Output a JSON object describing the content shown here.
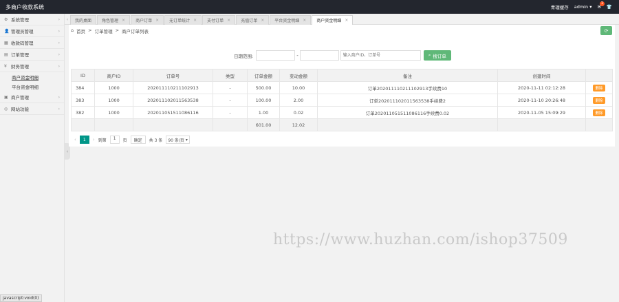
{
  "app_title": "多商户收款系统",
  "topbar": {
    "clear_cache": "青理缓存",
    "user": "admin",
    "notif_count": "1"
  },
  "sidebar": {
    "items": [
      {
        "label": "系统管理",
        "icon": "gear-icon"
      },
      {
        "label": "管理员管理",
        "icon": "user-icon"
      },
      {
        "label": "收款码管理",
        "icon": "qrcode-icon"
      },
      {
        "label": "订单管理",
        "icon": "doc-icon"
      },
      {
        "label": "财务管理",
        "icon": "money-icon"
      }
    ],
    "sub_items": [
      {
        "label": "商户资金明细",
        "active": true
      },
      {
        "label": "平台资金明细",
        "active": false
      }
    ],
    "items_after": [
      {
        "label": "商户管理",
        "icon": "store-icon"
      },
      {
        "label": "网站功能",
        "icon": "globe-icon"
      }
    ]
  },
  "status_url": "javascript:void(0)",
  "tabs": [
    {
      "label": "我的桌面",
      "active": false
    },
    {
      "label": "角色管理",
      "active": false
    },
    {
      "label": "商户订单",
      "active": false
    },
    {
      "label": "无订单统计",
      "active": false
    },
    {
      "label": "支付订单",
      "active": false
    },
    {
      "label": "充值订单",
      "active": false
    },
    {
      "label": "平台资金明细",
      "active": false
    },
    {
      "label": "商户资金明细",
      "active": true
    }
  ],
  "breadcrumb": {
    "home": "首页",
    "sep": ">",
    "level1": "订单管理",
    "level2": "商户订单列表"
  },
  "search": {
    "label": "日期范围:",
    "dash": "-",
    "keyword_placeholder": "输入商户ID、订单号",
    "button": "搜订单"
  },
  "table": {
    "headers": [
      "ID",
      "商户ID",
      "订单号",
      "类型",
      "订单金额",
      "变动金额",
      "备注",
      "创建时间",
      ""
    ],
    "rows": [
      {
        "id": "384",
        "merchant": "1000",
        "order": "202011110211102913",
        "type": "-",
        "amount": "500.00",
        "change": "10.00",
        "remark": "订单202011110211102913手续费10",
        "time": "2020-11-11 02:12:28",
        "action": "删除"
      },
      {
        "id": "383",
        "merchant": "1000",
        "order": "202011102011563538",
        "type": "-",
        "amount": "100.00",
        "change": "2.00",
        "remark": "订单202011102011563538手续费2",
        "time": "2020-11-10 20:26:48",
        "action": "删除"
      },
      {
        "id": "382",
        "merchant": "1000",
        "order": "202011051511086116",
        "type": "-",
        "amount": "1.00",
        "change": "0.02",
        "remark": "订单202011051511086116手续费0.02",
        "time": "2020-11-05 15:09:29",
        "action": "删除"
      }
    ],
    "total": {
      "amount": "601.00",
      "change": "12.02"
    }
  },
  "pager": {
    "current": "1",
    "goto_label": "到第",
    "goto_value": "1",
    "page_label": "页",
    "confirm": "确定",
    "count": "共 3 条",
    "per_page": "90 条/页"
  },
  "watermark": "https://www.huzhan.com/ishop37509"
}
